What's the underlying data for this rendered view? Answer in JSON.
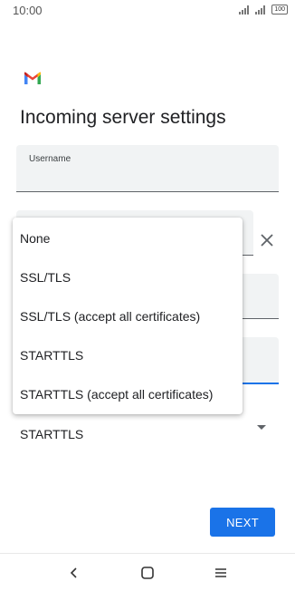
{
  "status_bar": {
    "time": "10:00",
    "battery": "100"
  },
  "page": {
    "title": "Incoming server settings"
  },
  "fields": {
    "username_label": "Username"
  },
  "security": {
    "selected_value": "STARTTLS",
    "options": [
      "None",
      "SSL/TLS",
      "SSL/TLS (accept all certificates)",
      "STARTTLS",
      "STARTTLS (accept all certificates)"
    ]
  },
  "actions": {
    "next_label": "NEXT"
  },
  "colors": {
    "accent": "#1a73e8",
    "field_bg": "#f1f3f4"
  },
  "icons": {
    "logo": "gmail-logo-icon",
    "clear": "close-icon",
    "back": "back-icon",
    "home": "home-icon",
    "menu": "menu-icon"
  }
}
